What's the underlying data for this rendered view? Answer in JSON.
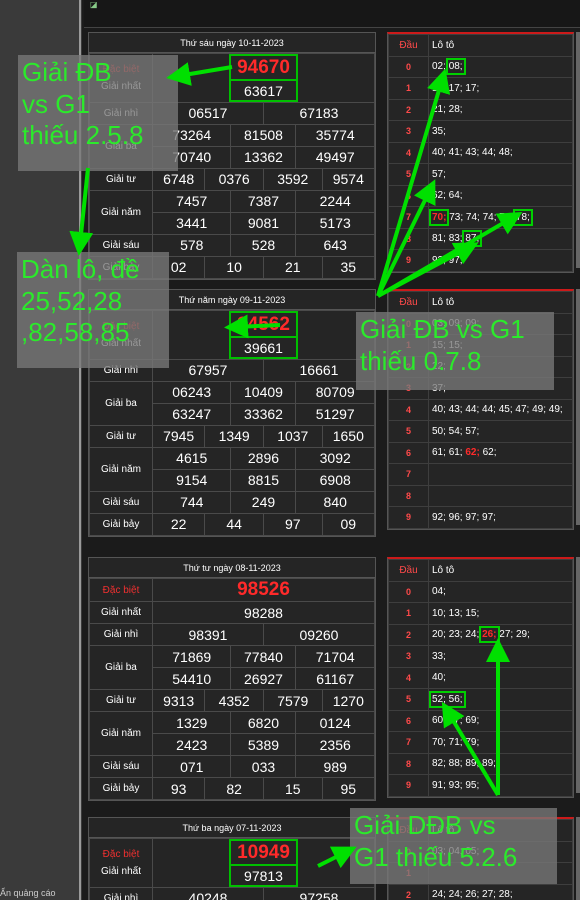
{
  "colors": {
    "accent_green": "#00e000",
    "prize_red": "#ff2a2a",
    "header_red": "#cc1a1a"
  },
  "labels": {
    "dau": "Đầu",
    "loto": "Lô tô",
    "ads": "Ẩn quảng cáo"
  },
  "blocks": [
    {
      "title": "Thứ sáu ngày 10-11-2023",
      "db_label": "Đặc biệt",
      "db": "94670",
      "g1_label": "Giải nhất",
      "g1": "63617",
      "g2_label": "Giải nhì",
      "g2": [
        "06517",
        "67183"
      ],
      "g3_label": "Giải ba",
      "g3": [
        "73264",
        "81508",
        "35774",
        "70740",
        "13362",
        "49497"
      ],
      "g4_label": "Giải tư",
      "g4": [
        "6748",
        "0376",
        "3592",
        "9574"
      ],
      "g5_label": "Giải năm",
      "g5": [
        "7457",
        "7387",
        "2244",
        "3441",
        "9081",
        "5173"
      ],
      "g6_label": "Giải sáu",
      "g6": [
        "578",
        "528",
        "643"
      ],
      "g7_label": "Giải bảy",
      "g7": [
        "02",
        "10",
        "21",
        "35"
      ],
      "loto": [
        {
          "d": "0",
          "v": "02; 08;"
        },
        {
          "d": "1",
          "v": "10; 17; 17;"
        },
        {
          "d": "2",
          "v": "21; 28;"
        },
        {
          "d": "3",
          "v": "35;"
        },
        {
          "d": "4",
          "v": "40; 41; 43; 44; 48;"
        },
        {
          "d": "5",
          "v": "57;"
        },
        {
          "d": "6",
          "v": "62; 64;"
        },
        {
          "d": "7",
          "v": "70; 73; 74; 74; 76; 78;"
        },
        {
          "d": "8",
          "v": "81; 83; 87;"
        },
        {
          "d": "9",
          "v": "92; 97;"
        }
      ]
    },
    {
      "title": "Thứ năm ngày 09-11-2023",
      "db_label": "Đặc biệt",
      "db": "34562",
      "g1_label": "Giải nhất",
      "g1": "39661",
      "g2_label": "Giải nhì",
      "g2": [
        "67957",
        "16661"
      ],
      "g3_label": "Giải ba",
      "g3": [
        "06243",
        "10409",
        "80709",
        "63247",
        "33362",
        "51297"
      ],
      "g4_label": "Giải tư",
      "g4": [
        "7945",
        "1349",
        "1037",
        "1650"
      ],
      "g5_label": "Giải năm",
      "g5": [
        "4615",
        "2896",
        "3092",
        "9154",
        "8815",
        "6908"
      ],
      "g6_label": "Giải sáu",
      "g6": [
        "744",
        "249",
        "840"
      ],
      "g7_label": "Giải bảy",
      "g7": [
        "22",
        "44",
        "97",
        "09"
      ],
      "loto": [
        {
          "d": "0",
          "v": "03; 09; 09;"
        },
        {
          "d": "1",
          "v": "15; 15;"
        },
        {
          "d": "2",
          "v": "22;"
        },
        {
          "d": "3",
          "v": "37;"
        },
        {
          "d": "4",
          "v": "40; 43; 44; 44; 45; 47; 49; 49;"
        },
        {
          "d": "5",
          "v": "50; 54; 57;"
        },
        {
          "d": "6",
          "v": "61; 61; 62; 62;"
        },
        {
          "d": "7",
          "v": ""
        },
        {
          "d": "8",
          "v": ""
        },
        {
          "d": "9",
          "v": "92; 96; 97; 97;"
        }
      ]
    },
    {
      "title": "Thứ tư ngày 08-11-2023",
      "db_label": "Đặc biệt",
      "db": "98526",
      "g1_label": "Giải nhất",
      "g1": "98288",
      "g2_label": "Giải nhì",
      "g2": [
        "98391",
        "09260"
      ],
      "g3_label": "Giải ba",
      "g3": [
        "71869",
        "77840",
        "71704",
        "54410",
        "26927",
        "61167"
      ],
      "g4_label": "Giải tư",
      "g4": [
        "9313",
        "4352",
        "7579",
        "1270"
      ],
      "g5_label": "Giải năm",
      "g5": [
        "1329",
        "6820",
        "0124",
        "2423",
        "5389",
        "2356"
      ],
      "g6_label": "Giải sáu",
      "g6": [
        "071",
        "033",
        "989"
      ],
      "g7_label": "Giải bảy",
      "g7": [
        "93",
        "82",
        "15",
        "95"
      ],
      "loto": [
        {
          "d": "0",
          "v": "04;"
        },
        {
          "d": "1",
          "v": "10; 13; 15;"
        },
        {
          "d": "2",
          "v": "20; 23; 24; 26; 27; 29;"
        },
        {
          "d": "3",
          "v": "33;"
        },
        {
          "d": "4",
          "v": "40;"
        },
        {
          "d": "5",
          "v": "52; 56;"
        },
        {
          "d": "6",
          "v": "60; 67; 69;"
        },
        {
          "d": "7",
          "v": "70; 71; 79;"
        },
        {
          "d": "8",
          "v": "82; 88; 89; 89;"
        },
        {
          "d": "9",
          "v": "91; 93; 95;"
        }
      ]
    },
    {
      "title": "Thứ ba ngày 07-11-2023",
      "db_label": "Đặc biệt",
      "db": "10949",
      "g1_label": "Giải nhất",
      "g1": "97813",
      "g2_label": "Giải nhì",
      "g2": [
        "40248",
        "97258"
      ],
      "loto": [
        {
          "d": "0",
          "v": "03; 04; 05;"
        },
        {
          "d": "1",
          "v": ""
        },
        {
          "d": "2",
          "v": "24; 24; 26; 27; 28;"
        }
      ]
    }
  ],
  "overlays": {
    "o1": "Giải ĐB\nvs G1\nthiếu 2.5.8",
    "o2": "Dàn lô, đề\n25,52,28\n,82,58,85",
    "o3": "Giải ĐB vs G1\nthiếu 0.7.8",
    "o4": "Giải DĐB vs\nG1 thiếu 5.2.6"
  }
}
